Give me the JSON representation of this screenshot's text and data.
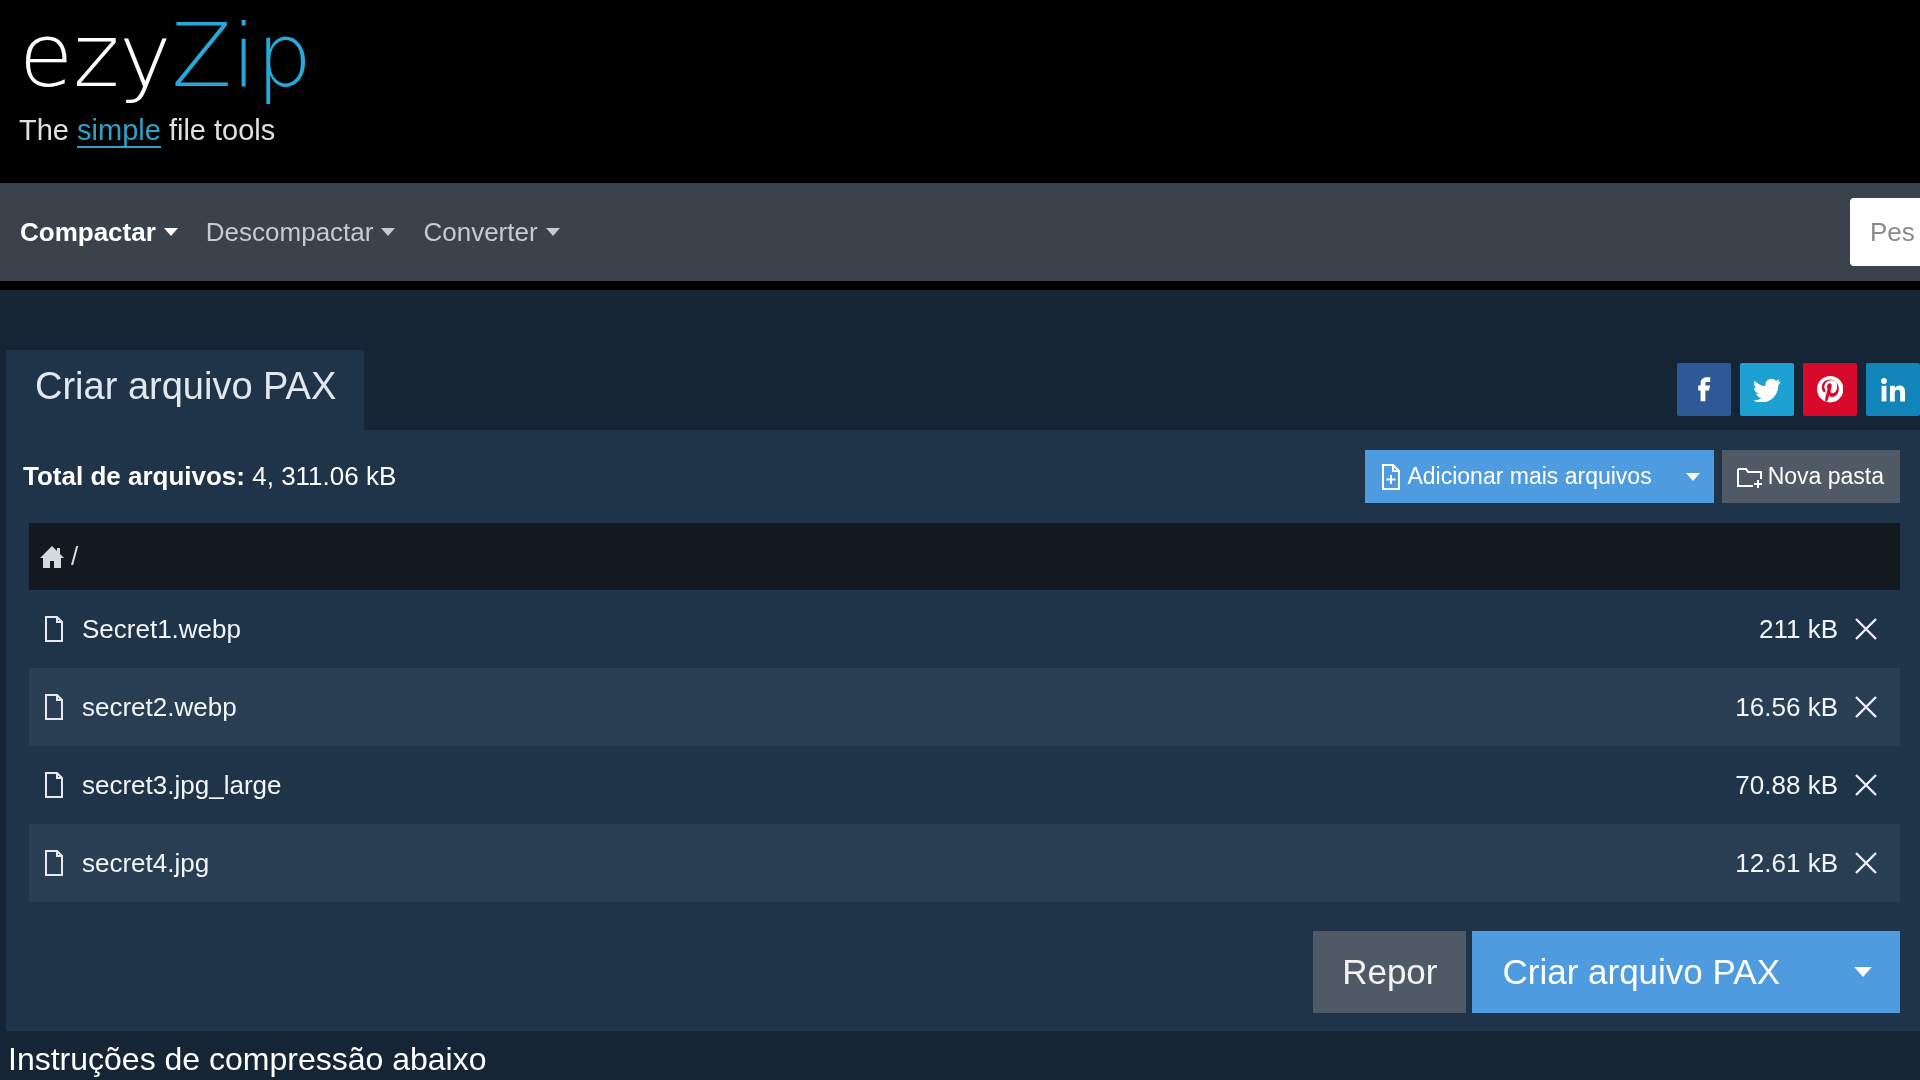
{
  "logo": {
    "brand_start": "ezy",
    "brand_end": "Zip",
    "tagline_before": "The",
    "tagline_highlight": "simple",
    "tagline_after": "file tools"
  },
  "nav": {
    "menus": [
      {
        "label": "Compactar",
        "selected": true
      },
      {
        "label": "Descompactar",
        "selected": false
      },
      {
        "label": "Converter",
        "selected": false
      }
    ],
    "search": {
      "placeholder": "Pes"
    }
  },
  "tab": {
    "title": "Criar arquivo PAX"
  },
  "share_buttons": [
    {
      "kind": "facebook",
      "color": "#2d5a94"
    },
    {
      "kind": "twitter",
      "color": "#1da1d2"
    },
    {
      "kind": "pinterest",
      "color": "#d8092b"
    },
    {
      "kind": "linkedin",
      "color": "#1185b9"
    }
  ],
  "summary": {
    "label": "Total de arquivos:",
    "value": "4, 311.06 kB"
  },
  "toolbar": {
    "add_files": "Adicionar mais arquivos",
    "new_folder": "Nova pasta"
  },
  "breadcrumb": {
    "path": "/"
  },
  "files": [
    {
      "name": "Secret1.webp",
      "size": "211 kB"
    },
    {
      "name": "secret2.webp",
      "size": "16.56 kB"
    },
    {
      "name": "secret3.jpg_large",
      "size": "70.88 kB"
    },
    {
      "name": "secret4.jpg",
      "size": "12.61 kB"
    }
  ],
  "actions": {
    "reset": "Repor",
    "create": "Criar arquivo PAX"
  },
  "instructions_heading": "Instruções de compressão abaixo"
}
